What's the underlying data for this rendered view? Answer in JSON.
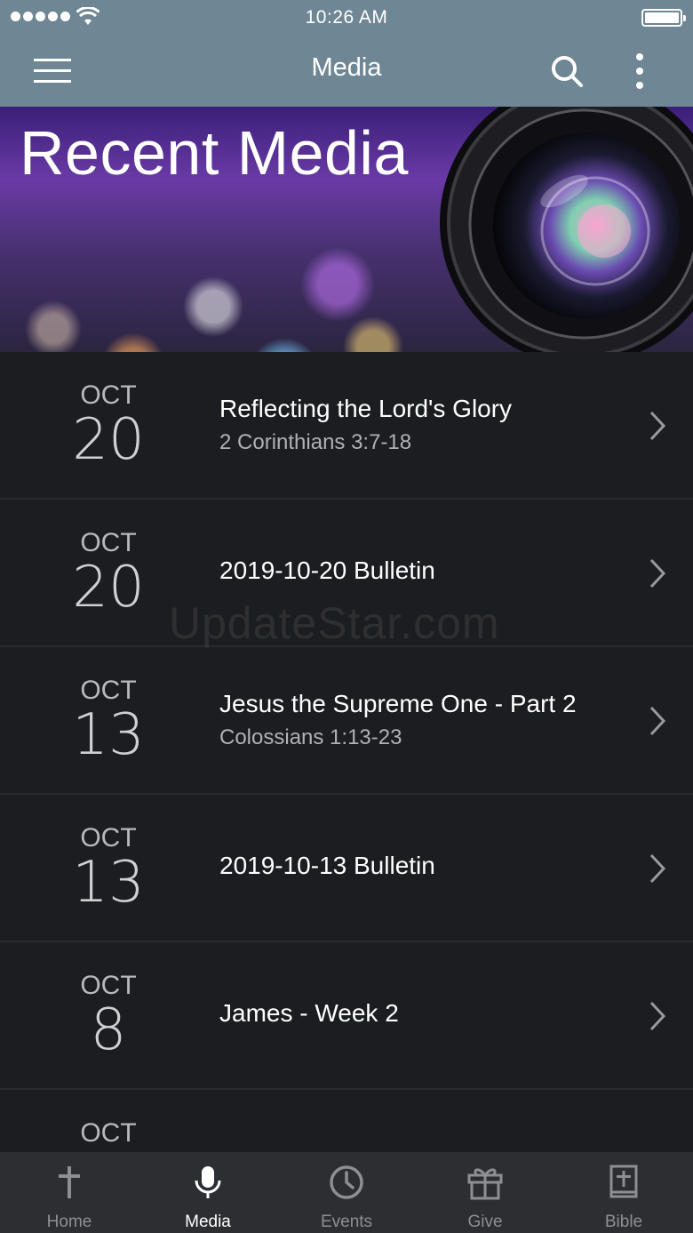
{
  "status_bar": {
    "time": "10:26 AM"
  },
  "nav": {
    "title": "Media"
  },
  "hero": {
    "title": "Recent Media"
  },
  "media_items": [
    {
      "month": "OCT",
      "day": "20",
      "title": "Reflecting the Lord's Glory",
      "subtitle": "2 Corinthians 3:7-18"
    },
    {
      "month": "OCT",
      "day": "20",
      "title": "2019-10-20 Bulletin",
      "subtitle": ""
    },
    {
      "month": "OCT",
      "day": "13",
      "title": "Jesus the Supreme One - Part 2",
      "subtitle": "Colossians 1:13-23"
    },
    {
      "month": "OCT",
      "day": "13",
      "title": "2019-10-13 Bulletin",
      "subtitle": ""
    },
    {
      "month": "OCT",
      "day": "8",
      "title": "James - Week 2",
      "subtitle": ""
    },
    {
      "month": "OCT",
      "day": "",
      "title": "",
      "subtitle": ""
    }
  ],
  "watermark": "UpdateStar.com",
  "tabs": [
    {
      "label": "Home",
      "icon": "cross-icon",
      "active": false
    },
    {
      "label": "Media",
      "icon": "microphone-icon",
      "active": true
    },
    {
      "label": "Events",
      "icon": "clock-icon",
      "active": false
    },
    {
      "label": "Give",
      "icon": "gift-icon",
      "active": false
    },
    {
      "label": "Bible",
      "icon": "bible-icon",
      "active": false
    }
  ],
  "colors": {
    "nav_bar": "#6f8694",
    "background": "#1b1c1f",
    "tab_bar": "#2d2e31",
    "tab_active": "#ffffff",
    "tab_inactive": "#8e8f93"
  }
}
